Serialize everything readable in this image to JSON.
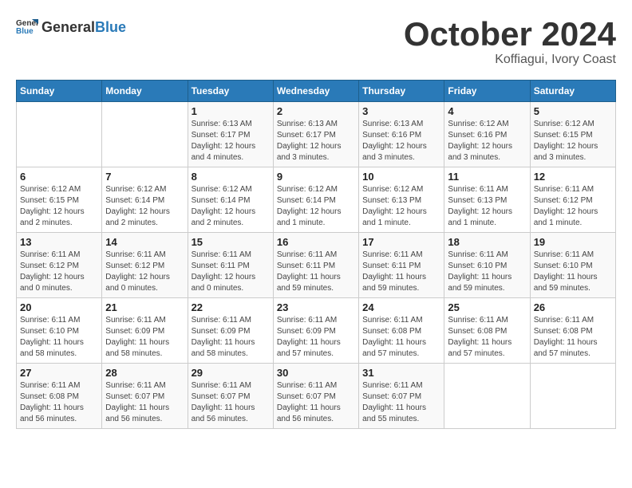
{
  "logo": {
    "general": "General",
    "blue": "Blue"
  },
  "header": {
    "month": "October 2024",
    "location": "Koffiagui, Ivory Coast"
  },
  "weekdays": [
    "Sunday",
    "Monday",
    "Tuesday",
    "Wednesday",
    "Thursday",
    "Friday",
    "Saturday"
  ],
  "weeks": [
    [
      {
        "day": "",
        "detail": ""
      },
      {
        "day": "",
        "detail": ""
      },
      {
        "day": "1",
        "detail": "Sunrise: 6:13 AM\nSunset: 6:17 PM\nDaylight: 12 hours and 4 minutes."
      },
      {
        "day": "2",
        "detail": "Sunrise: 6:13 AM\nSunset: 6:17 PM\nDaylight: 12 hours and 3 minutes."
      },
      {
        "day": "3",
        "detail": "Sunrise: 6:13 AM\nSunset: 6:16 PM\nDaylight: 12 hours and 3 minutes."
      },
      {
        "day": "4",
        "detail": "Sunrise: 6:12 AM\nSunset: 6:16 PM\nDaylight: 12 hours and 3 minutes."
      },
      {
        "day": "5",
        "detail": "Sunrise: 6:12 AM\nSunset: 6:15 PM\nDaylight: 12 hours and 3 minutes."
      }
    ],
    [
      {
        "day": "6",
        "detail": "Sunrise: 6:12 AM\nSunset: 6:15 PM\nDaylight: 12 hours and 2 minutes."
      },
      {
        "day": "7",
        "detail": "Sunrise: 6:12 AM\nSunset: 6:14 PM\nDaylight: 12 hours and 2 minutes."
      },
      {
        "day": "8",
        "detail": "Sunrise: 6:12 AM\nSunset: 6:14 PM\nDaylight: 12 hours and 2 minutes."
      },
      {
        "day": "9",
        "detail": "Sunrise: 6:12 AM\nSunset: 6:14 PM\nDaylight: 12 hours and 1 minute."
      },
      {
        "day": "10",
        "detail": "Sunrise: 6:12 AM\nSunset: 6:13 PM\nDaylight: 12 hours and 1 minute."
      },
      {
        "day": "11",
        "detail": "Sunrise: 6:11 AM\nSunset: 6:13 PM\nDaylight: 12 hours and 1 minute."
      },
      {
        "day": "12",
        "detail": "Sunrise: 6:11 AM\nSunset: 6:12 PM\nDaylight: 12 hours and 1 minute."
      }
    ],
    [
      {
        "day": "13",
        "detail": "Sunrise: 6:11 AM\nSunset: 6:12 PM\nDaylight: 12 hours and 0 minutes."
      },
      {
        "day": "14",
        "detail": "Sunrise: 6:11 AM\nSunset: 6:12 PM\nDaylight: 12 hours and 0 minutes."
      },
      {
        "day": "15",
        "detail": "Sunrise: 6:11 AM\nSunset: 6:11 PM\nDaylight: 12 hours and 0 minutes."
      },
      {
        "day": "16",
        "detail": "Sunrise: 6:11 AM\nSunset: 6:11 PM\nDaylight: 11 hours and 59 minutes."
      },
      {
        "day": "17",
        "detail": "Sunrise: 6:11 AM\nSunset: 6:11 PM\nDaylight: 11 hours and 59 minutes."
      },
      {
        "day": "18",
        "detail": "Sunrise: 6:11 AM\nSunset: 6:10 PM\nDaylight: 11 hours and 59 minutes."
      },
      {
        "day": "19",
        "detail": "Sunrise: 6:11 AM\nSunset: 6:10 PM\nDaylight: 11 hours and 59 minutes."
      }
    ],
    [
      {
        "day": "20",
        "detail": "Sunrise: 6:11 AM\nSunset: 6:10 PM\nDaylight: 11 hours and 58 minutes."
      },
      {
        "day": "21",
        "detail": "Sunrise: 6:11 AM\nSunset: 6:09 PM\nDaylight: 11 hours and 58 minutes."
      },
      {
        "day": "22",
        "detail": "Sunrise: 6:11 AM\nSunset: 6:09 PM\nDaylight: 11 hours and 58 minutes."
      },
      {
        "day": "23",
        "detail": "Sunrise: 6:11 AM\nSunset: 6:09 PM\nDaylight: 11 hours and 57 minutes."
      },
      {
        "day": "24",
        "detail": "Sunrise: 6:11 AM\nSunset: 6:08 PM\nDaylight: 11 hours and 57 minutes."
      },
      {
        "day": "25",
        "detail": "Sunrise: 6:11 AM\nSunset: 6:08 PM\nDaylight: 11 hours and 57 minutes."
      },
      {
        "day": "26",
        "detail": "Sunrise: 6:11 AM\nSunset: 6:08 PM\nDaylight: 11 hours and 57 minutes."
      }
    ],
    [
      {
        "day": "27",
        "detail": "Sunrise: 6:11 AM\nSunset: 6:08 PM\nDaylight: 11 hours and 56 minutes."
      },
      {
        "day": "28",
        "detail": "Sunrise: 6:11 AM\nSunset: 6:07 PM\nDaylight: 11 hours and 56 minutes."
      },
      {
        "day": "29",
        "detail": "Sunrise: 6:11 AM\nSunset: 6:07 PM\nDaylight: 11 hours and 56 minutes."
      },
      {
        "day": "30",
        "detail": "Sunrise: 6:11 AM\nSunset: 6:07 PM\nDaylight: 11 hours and 56 minutes."
      },
      {
        "day": "31",
        "detail": "Sunrise: 6:11 AM\nSunset: 6:07 PM\nDaylight: 11 hours and 55 minutes."
      },
      {
        "day": "",
        "detail": ""
      },
      {
        "day": "",
        "detail": ""
      }
    ]
  ]
}
